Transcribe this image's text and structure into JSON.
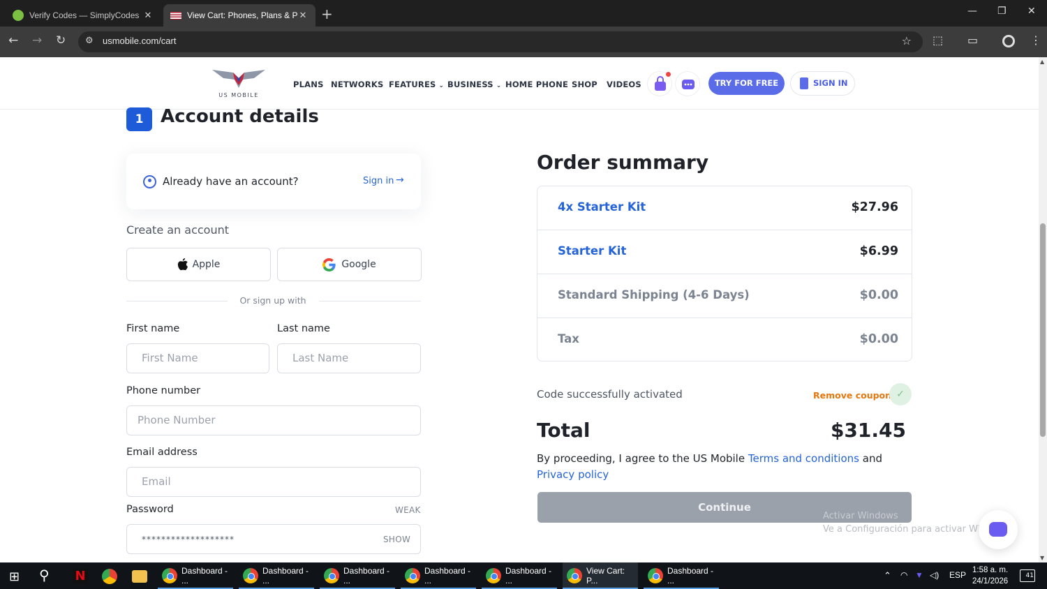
{
  "browser": {
    "tabs": [
      {
        "title": "Verify Codes — SimplyCodes",
        "favicon_color": "#7bc043"
      },
      {
        "title": "View Cart: Phones, Plans & Pay",
        "favicon_color": "#b22234"
      }
    ],
    "url": "usmobile.com/cart"
  },
  "header": {
    "logo_text": "US MOBILE",
    "nav": [
      "PLANS",
      "NETWORKS",
      "FEATURES",
      "BUSINESS",
      "HOME PHONE",
      "SHOP",
      "VIDEOS"
    ],
    "try_label": "TRY FOR FREE",
    "signin_label": "SIGN IN"
  },
  "account": {
    "step": "1",
    "title": "Account details",
    "have_account": "Already have an account?",
    "sign_in_link": "Sign in",
    "create_label": "Create an account",
    "apple_label": "Apple",
    "google_label": "Google",
    "or_text": "Or sign up with",
    "first_name_label": "First name",
    "first_name_placeholder": "First Name",
    "last_name_label": "Last name",
    "last_name_placeholder": "Last Name",
    "phone_label": "Phone number",
    "phone_placeholder": "Phone Number",
    "email_label": "Email address",
    "email_placeholder": "Email",
    "password_label": "Password",
    "password_strength": "WEAK",
    "password_value": "*******************",
    "show_label": "SHOW"
  },
  "order": {
    "title": "Order summary",
    "rows": [
      {
        "name": "4x Starter Kit",
        "price": "$27.96"
      },
      {
        "name": "Starter Kit",
        "price": "$6.99"
      },
      {
        "name": "Standard Shipping (4-6 Days)",
        "price": "$0.00"
      },
      {
        "name": "Tax",
        "price": "$0.00"
      }
    ],
    "code_message": "Code successfully activated",
    "remove_coupon": "Remove coupon",
    "total_label": "Total",
    "total_value": "$31.45",
    "agree_prefix": "By proceeding, I agree to the US Mobile",
    "terms_link": "Terms and conditions",
    "and_text": "and",
    "privacy_link": "Privacy policy",
    "continue_label": "Continue"
  },
  "watermark": {
    "line1": "Activar Windows",
    "line2": "Ve a Configuración para activar Windows."
  },
  "taskbar": {
    "items": [
      "Dashboard - ...",
      "Dashboard - ...",
      "Dashboard - ...",
      "Dashboard - ...",
      "Dashboard - ...",
      "View Cart: P...",
      "Dashboard - ..."
    ],
    "language": "ESP",
    "time": "1:58 a. m.",
    "date": "24/1/2026",
    "notifications": "41"
  }
}
